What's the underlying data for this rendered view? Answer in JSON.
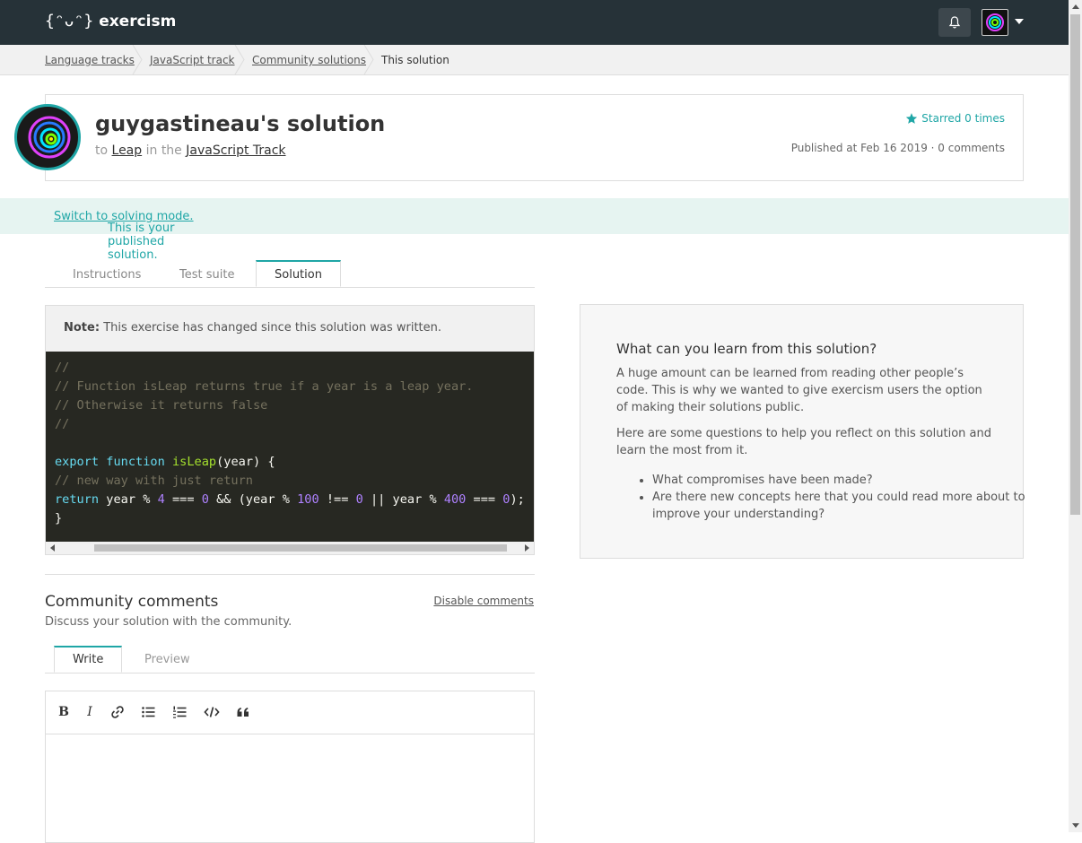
{
  "app": {
    "brand": "exercism",
    "logo_glyph": "{ᵔᴗᵔ}"
  },
  "breadcrumb": [
    "Language tracks",
    "JavaScript track",
    "Community solutions",
    "This solution"
  ],
  "solution": {
    "title": "guygastineau's solution",
    "to": "to",
    "exercise": "Leap",
    "in_the": "in the",
    "track": "JavaScript Track",
    "starred": "Starred 0 times",
    "published": "Published at Feb 16 2019 · 0 comments"
  },
  "notice": {
    "text": "This is your published solution.",
    "link": "Switch to solving mode."
  },
  "tabs": [
    "Instructions",
    "Test suite",
    "Solution"
  ],
  "code": {
    "note_label": "Note:",
    "note_text": "This exercise has changed since this solution was written."
  },
  "learn": {
    "title": "What can you learn from this solution?",
    "p1": "A huge amount can be learned from reading other people’s code. This is why we wanted to give exercism users the option of making their solutions public.",
    "p2": "Here are some questions to help you reflect on this solution and learn the most from it.",
    "items": [
      "What compromises have been made?",
      "Are there new concepts here that you could read more about to improve your understanding?"
    ]
  },
  "comments": {
    "title": "Community comments",
    "subtitle": "Discuss your solution with the community.",
    "disable": "Disable comments",
    "tabs": [
      "Write",
      "Preview"
    ]
  },
  "toolbar": {
    "bold": "B",
    "italic": "I"
  },
  "colors": {
    "accent": "#1fa6a6",
    "topbar": "#263238",
    "code_bg": "#272822"
  }
}
